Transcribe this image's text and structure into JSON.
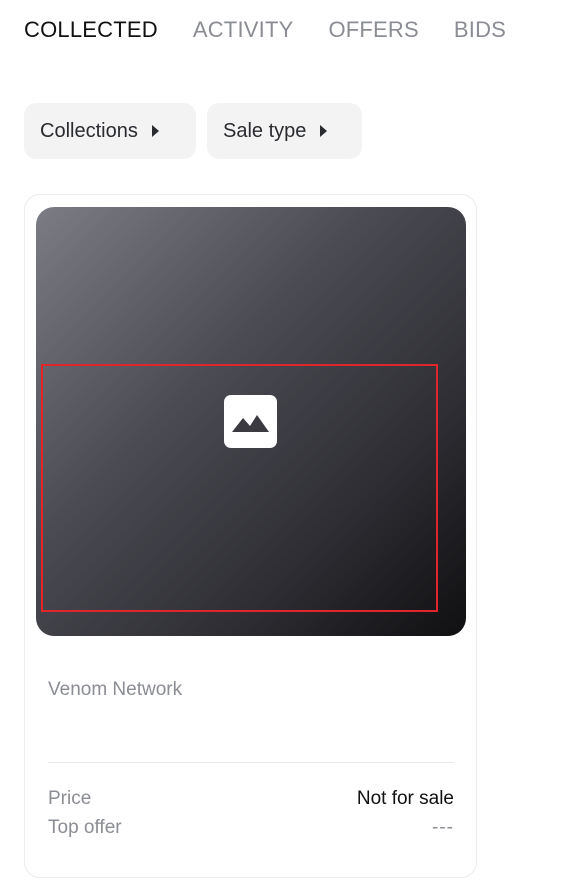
{
  "tabs": [
    {
      "label": "COLLECTED",
      "active": true
    },
    {
      "label": "ACTIVITY",
      "active": false
    },
    {
      "label": "OFFERS",
      "active": false
    },
    {
      "label": "BIDS",
      "active": false
    }
  ],
  "filters": {
    "collections_label": "Collections",
    "sale_type_label": "Sale type"
  },
  "card": {
    "media_icon": "image-placeholder-icon",
    "collection_name": "Venom Network",
    "price_label": "Price",
    "price_value": "Not for sale",
    "top_offer_label": "Top offer",
    "top_offer_value": "---"
  },
  "colors": {
    "highlight": "#e0262b",
    "text_primary": "#111111",
    "text_muted": "#8b8d94",
    "filter_bg": "#f3f3f4"
  }
}
